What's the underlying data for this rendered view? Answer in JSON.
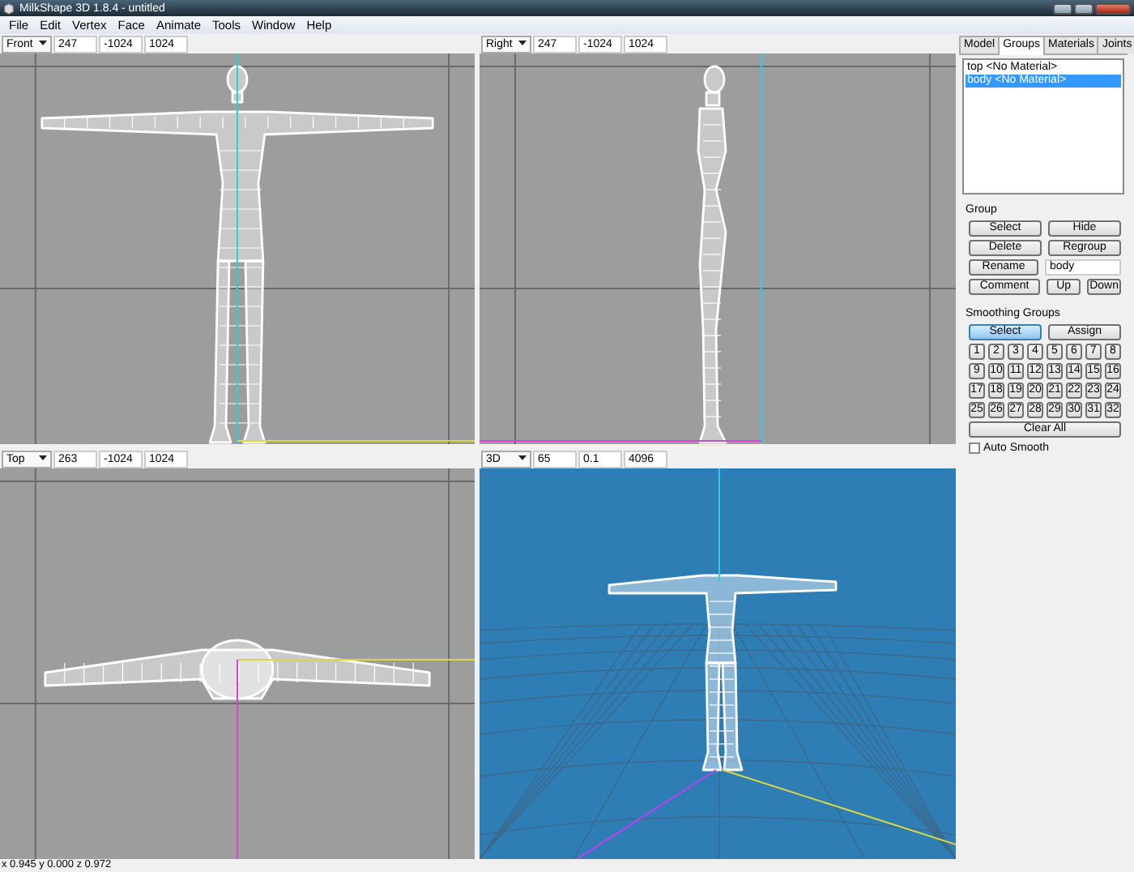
{
  "window": {
    "title": "MilkShape 3D 1.8.4 - untitled"
  },
  "menu": [
    "File",
    "Edit",
    "Vertex",
    "Face",
    "Animate",
    "Tools",
    "Window",
    "Help"
  ],
  "viewports": [
    {
      "kind": "front",
      "view": "Front",
      "fields": [
        "247",
        "-1024",
        "1024"
      ]
    },
    {
      "kind": "side",
      "view": "Right",
      "fields": [
        "247",
        "-1024",
        "1024"
      ]
    },
    {
      "kind": "top",
      "view": "Top",
      "fields": [
        "263",
        "-1024",
        "1024"
      ]
    },
    {
      "kind": "perspective",
      "view": "3D",
      "fields": [
        "65",
        "0.1",
        "4096"
      ]
    }
  ],
  "panel": {
    "tabs": [
      {
        "label": "Model",
        "selected": false
      },
      {
        "label": "Groups",
        "selected": true
      },
      {
        "label": "Materials",
        "selected": false
      },
      {
        "label": "Joints",
        "selected": false
      }
    ],
    "groups": [
      {
        "label": "top <No Material>",
        "selected": false
      },
      {
        "label": "body <No Material>",
        "selected": true
      }
    ],
    "group_title": "Group",
    "group_buttons": [
      [
        "Select",
        "Hide"
      ],
      [
        "Delete",
        "Regroup"
      ]
    ],
    "rename_button": "Rename",
    "name_field": "body",
    "order_buttons": [
      "Comment",
      "Up",
      "Down"
    ],
    "smoothing": {
      "title": "Smoothing Groups",
      "modes": [
        {
          "label": "Select",
          "selected": true
        },
        {
          "label": "Assign",
          "selected": false
        }
      ],
      "numbers": [
        "1",
        "2",
        "3",
        "4",
        "5",
        "6",
        "7",
        "8",
        "9",
        "10",
        "11",
        "12",
        "13",
        "14",
        "15",
        "16",
        "17",
        "18",
        "19",
        "20",
        "21",
        "22",
        "23",
        "24",
        "25",
        "26",
        "27",
        "28",
        "29",
        "30",
        "31",
        "32"
      ],
      "clear_button": "Clear All",
      "auto_smooth": {
        "label": "Auto Smooth",
        "checked": false
      }
    }
  },
  "status_bar": "x 0.945 y 0.000 z 0.972"
}
